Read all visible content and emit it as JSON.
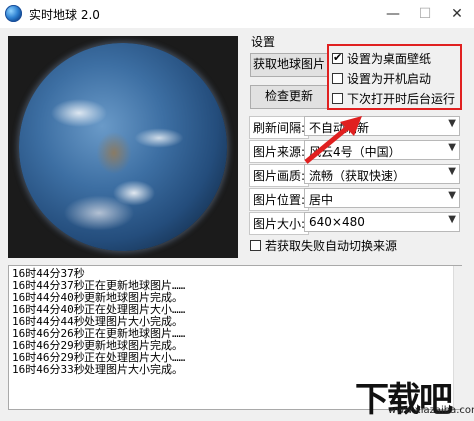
{
  "window": {
    "title": "实时地球 2.0",
    "min_symbol": "—",
    "max_symbol": "☐",
    "close_symbol": "✕"
  },
  "settings": {
    "group_label": "设置",
    "fetch_button": "获取地球图片",
    "check_update_button": "检查更新",
    "checkboxes": [
      {
        "label": "设置为桌面壁纸",
        "checked": true
      },
      {
        "label": "设置为开机启动",
        "checked": false
      },
      {
        "label": "下次打开时后台运行",
        "checked": false
      }
    ],
    "fields": [
      {
        "label": "刷新间隔:",
        "value": "不自动刷新"
      },
      {
        "label": "图片来源:",
        "value": "风云4号（中国）"
      },
      {
        "label": "图片画质:",
        "value": "流畅（获取快速）"
      },
      {
        "label": "图片位置:",
        "value": "居中"
      },
      {
        "label": "图片大小:",
        "value": "640×480"
      }
    ],
    "fallback_checkbox": {
      "label": "若获取失败自动切换来源",
      "checked": false
    }
  },
  "log": [
    {
      "time": "16时44分37秒",
      "msg": ""
    },
    {
      "time": "16时44分37秒",
      "msg": "正在更新地球图片……"
    },
    {
      "time": "16时44分40秒",
      "msg": "更新地球图片完成。"
    },
    {
      "time": "16时44分40秒",
      "msg": "正在处理图片大小……"
    },
    {
      "time": "16时44分44秒",
      "msg": "处理图片大小完成。"
    },
    {
      "time": "16时46分26秒",
      "msg": "正在更新地球图片……"
    },
    {
      "time": "16时46分29秒",
      "msg": "更新地球图片完成。"
    },
    {
      "time": "16时46分29秒",
      "msg": "正在处理图片大小……"
    },
    {
      "time": "16时46分33秒",
      "msg": "处理图片大小完成。"
    }
  ],
  "watermark": {
    "text": "下载吧",
    "sub": "www.xiazaiba.com"
  },
  "colors": {
    "highlight": "#e02020",
    "background": "#f0f0f0"
  },
  "icons": {
    "app": "earth-icon",
    "dropdown": "chevron-down-icon"
  }
}
